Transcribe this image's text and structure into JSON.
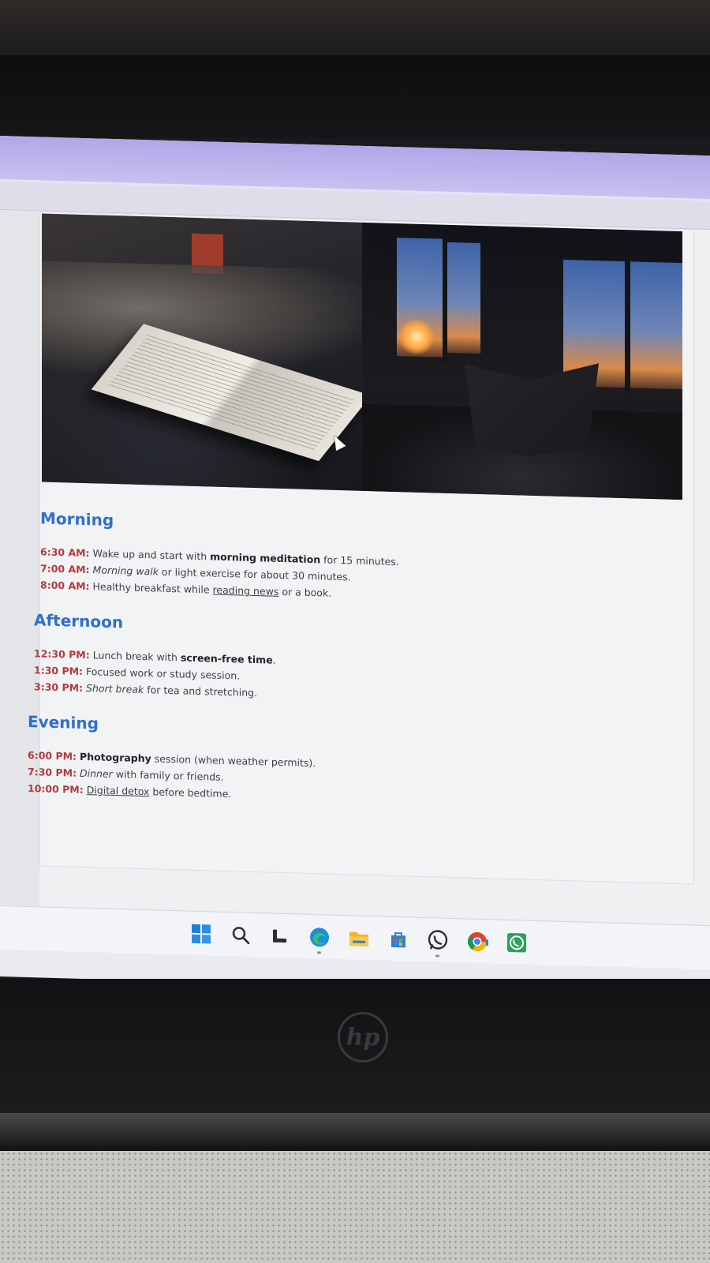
{
  "schedule": {
    "sections": [
      {
        "title": "Morning",
        "entries": [
          {
            "time": "6:30 AM:",
            "parts": [
              " Wake up and start with ",
              "morning meditation",
              " for 15 minutes."
            ],
            "styles": [
              "",
              "bold",
              ""
            ]
          },
          {
            "time": "7:00 AM:",
            "parts": [
              " ",
              "Morning walk",
              " or light exercise for about 30 minutes."
            ],
            "styles": [
              "",
              "italic",
              ""
            ]
          },
          {
            "time": "8:00 AM:",
            "parts": [
              " Healthy breakfast while ",
              "reading news",
              " or a book."
            ],
            "styles": [
              "",
              "underline",
              ""
            ]
          }
        ]
      },
      {
        "title": "Afternoon",
        "entries": [
          {
            "time": "12:30 PM:",
            "parts": [
              " Lunch break with ",
              "screen-free time",
              "."
            ],
            "styles": [
              "",
              "bold",
              ""
            ]
          },
          {
            "time": "1:30 PM:",
            "parts": [
              " Focused work or study session."
            ],
            "styles": [
              ""
            ]
          },
          {
            "time": "3:30 PM:",
            "parts": [
              " ",
              "Short break",
              " for tea and stretching."
            ],
            "styles": [
              "",
              "italic",
              ""
            ]
          }
        ]
      },
      {
        "title": "Evening",
        "entries": [
          {
            "time": "6:00 PM:",
            "parts": [
              " ",
              "Photography",
              " session (when weather permits)."
            ],
            "styles": [
              "",
              "bold",
              ""
            ]
          },
          {
            "time": "7:30 PM:",
            "parts": [
              " ",
              "Dinner",
              " with family or friends."
            ],
            "styles": [
              "",
              "italic",
              ""
            ]
          },
          {
            "time": "10:00 PM:",
            "parts": [
              " ",
              "Digital detox",
              " before bedtime."
            ],
            "styles": [
              "",
              "underline",
              ""
            ]
          }
        ]
      }
    ]
  },
  "images": [
    {
      "name": "reading-in-bed-photo",
      "subject": "open book on a bed"
    },
    {
      "name": "reading-by-window-photo",
      "subject": "reading by a window at sunset"
    }
  ],
  "taskbar": {
    "icons": [
      {
        "name": "start-icon",
        "color": "#1f7fd8"
      },
      {
        "name": "search-icon",
        "color": "#33353a"
      },
      {
        "name": "task-view-icon",
        "color": "#2a2c31"
      },
      {
        "name": "edge-icon",
        "color": "#1c8fd6"
      },
      {
        "name": "file-explorer-icon",
        "color": "#f2b632"
      },
      {
        "name": "microsoft-store-icon",
        "color": "#2d7fd3"
      },
      {
        "name": "whatsapp-icon",
        "color": "#2c2f35"
      },
      {
        "name": "chrome-icon",
        "color": "#db4437"
      },
      {
        "name": "whatsapp-business-icon",
        "color": "#25a45a"
      }
    ]
  },
  "device": {
    "brand_logo": "hp"
  },
  "colors": {
    "section_title": "#2f6fcb",
    "time_label": "#b23a3e",
    "browser_chrome": "#b3a6e9"
  }
}
